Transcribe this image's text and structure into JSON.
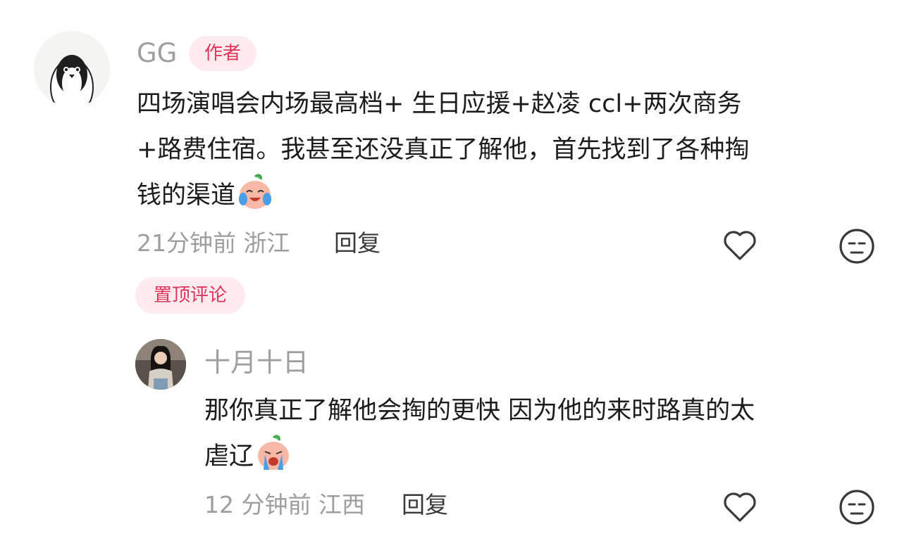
{
  "main_comment": {
    "username": "GG",
    "author_badge": "作者",
    "text_lines": [
      "四场演唱会内场最高档+ 生日应援+赵凌 ccl+两次商务",
      "+路费住宿。我甚至还没真正了解他，首先找到了各种掏",
      "钱的渠道"
    ],
    "emoji_icon": "crying-laughing-peach-emoji",
    "time": "21分钟前",
    "location": "浙江",
    "reply_label": "回复",
    "like_icon": "heart-outline-icon",
    "dislike_icon": "unamused-face-icon"
  },
  "pinned_label": "置顶评论",
  "reply_comment": {
    "username": "十月十日",
    "text_lines": [
      "那你真正了解他会掏的更快 因为他的来时路真的太",
      "虐辽"
    ],
    "emoji_icon": "crying-peach-emoji",
    "time": "12 分钟前",
    "location": "江西",
    "reply_label": "回复",
    "like_icon": "heart-outline-icon",
    "dislike_icon": "unamused-face-icon"
  },
  "colors": {
    "badge_bg": "#fdebef",
    "badge_text": "#e0345a",
    "meta_gray": "#9e9e9e",
    "body_text": "#1c1c1c"
  }
}
